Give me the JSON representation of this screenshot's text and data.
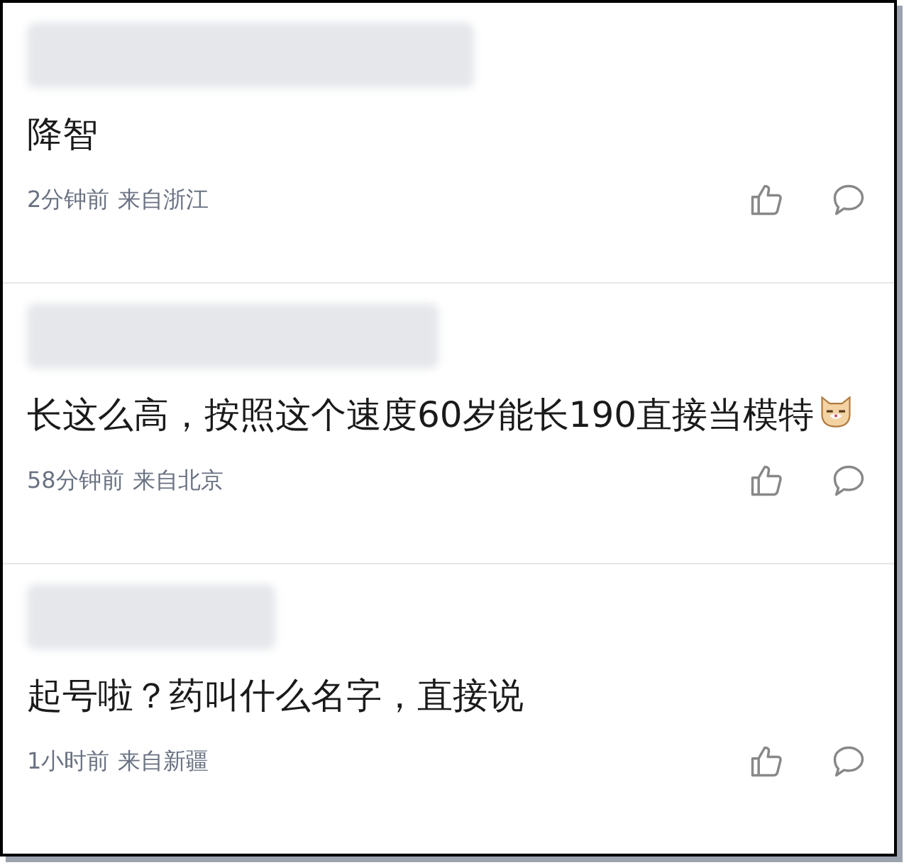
{
  "comments": [
    {
      "text": "降智",
      "time": "2分钟前",
      "location": "来自浙江",
      "emoji": false
    },
    {
      "text": "长这么高，按照这个速度60岁能长190直接当模特",
      "time": "58分钟前",
      "location": "来自北京",
      "emoji": true
    },
    {
      "text": "起号啦？药叫什么名字，直接说",
      "time": "1小时前",
      "location": "来自新疆",
      "emoji": false
    }
  ]
}
